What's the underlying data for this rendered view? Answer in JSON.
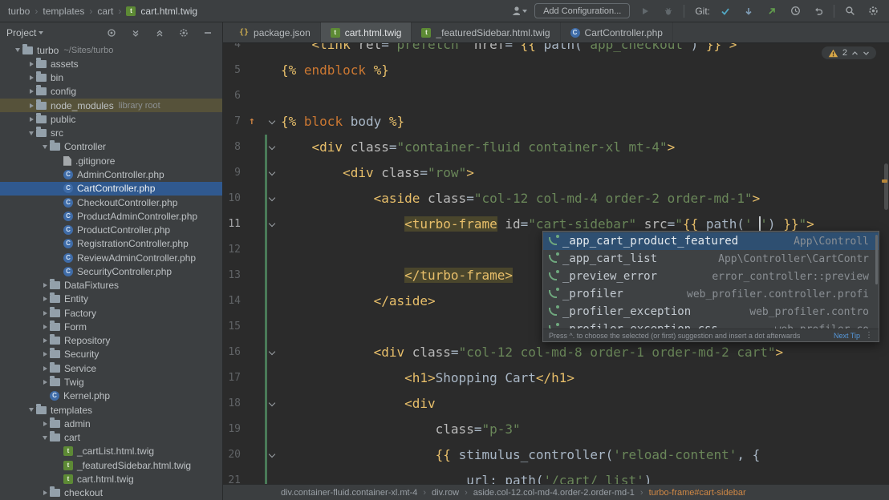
{
  "colors": {
    "editor_bg": "#2b2b2b",
    "panel_bg": "#3c3f41",
    "selection_blue": "#30598f",
    "library_highlight": "#56523a",
    "tag_yellow": "#e8bf6a",
    "string_green": "#6a8759",
    "keyword_orange": "#cc7832",
    "warning_yellow": "#d9a848",
    "breadcrumb_current": "#d08845"
  },
  "icons": {
    "breadcrumb_separator": "›",
    "overflow_menu": "⋮",
    "block_override_arrow": "↑"
  },
  "titlebar": {
    "path": [
      "turbo",
      "templates",
      "cart",
      "cart.html.twig"
    ],
    "add_config": "Add Configuration...",
    "git_label": "Git:"
  },
  "project": {
    "title": "Project",
    "items": [
      {
        "label": "turbo",
        "sub": "~/Sites/turbo",
        "type": "folder",
        "level": 0,
        "arrow": "open"
      },
      {
        "label": "assets",
        "type": "folder",
        "level": 1,
        "arrow": "closed"
      },
      {
        "label": "bin",
        "type": "folder",
        "level": 1,
        "arrow": "closed"
      },
      {
        "label": "config",
        "type": "folder",
        "level": 1,
        "arrow": "closed"
      },
      {
        "label": "node_modules",
        "sub": "library root",
        "type": "folder",
        "level": 1,
        "arrow": "closed",
        "highlight": true
      },
      {
        "label": "public",
        "type": "folder",
        "level": 1,
        "arrow": "closed"
      },
      {
        "label": "src",
        "type": "folder",
        "level": 1,
        "arrow": "open"
      },
      {
        "label": "Controller",
        "type": "folder",
        "level": 2,
        "arrow": "open"
      },
      {
        "label": ".gitignore",
        "type": "git",
        "level": 3
      },
      {
        "label": "AdminController.php",
        "type": "php",
        "level": 3
      },
      {
        "label": "CartController.php",
        "type": "php",
        "level": 3,
        "selected": true
      },
      {
        "label": "CheckoutController.php",
        "type": "php",
        "level": 3
      },
      {
        "label": "ProductAdminController.php",
        "type": "php",
        "level": 3
      },
      {
        "label": "ProductController.php",
        "type": "php",
        "level": 3
      },
      {
        "label": "RegistrationController.php",
        "type": "php",
        "level": 3
      },
      {
        "label": "ReviewAdminController.php",
        "type": "php",
        "level": 3
      },
      {
        "label": "SecurityController.php",
        "type": "php",
        "level": 3
      },
      {
        "label": "DataFixtures",
        "type": "folder",
        "level": 2,
        "arrow": "closed"
      },
      {
        "label": "Entity",
        "type": "folder",
        "level": 2,
        "arrow": "closed"
      },
      {
        "label": "Factory",
        "type": "folder",
        "level": 2,
        "arrow": "closed"
      },
      {
        "label": "Form",
        "type": "folder",
        "level": 2,
        "arrow": "closed"
      },
      {
        "label": "Repository",
        "type": "folder",
        "level": 2,
        "arrow": "closed"
      },
      {
        "label": "Security",
        "type": "folder",
        "level": 2,
        "arrow": "closed"
      },
      {
        "label": "Service",
        "type": "folder",
        "level": 2,
        "arrow": "closed"
      },
      {
        "label": "Twig",
        "type": "folder",
        "level": 2,
        "arrow": "closed"
      },
      {
        "label": "Kernel.php",
        "type": "php",
        "level": 2
      },
      {
        "label": "templates",
        "type": "folder",
        "level": 1,
        "arrow": "open"
      },
      {
        "label": "admin",
        "type": "folder",
        "level": 2,
        "arrow": "closed"
      },
      {
        "label": "cart",
        "type": "folder",
        "level": 2,
        "arrow": "open"
      },
      {
        "label": "_cartList.html.twig",
        "type": "twig",
        "level": 3
      },
      {
        "label": "_featuredSidebar.html.twig",
        "type": "twig",
        "level": 3
      },
      {
        "label": "cart.html.twig",
        "type": "twig",
        "level": 3
      },
      {
        "label": "checkout",
        "type": "folder",
        "level": 2,
        "arrow": "closed"
      }
    ]
  },
  "tabs": [
    {
      "label": "package.json",
      "icon": "json"
    },
    {
      "label": "cart.html.twig",
      "icon": "twig",
      "active": true
    },
    {
      "label": "_featuredSidebar.html.twig",
      "icon": "twig"
    },
    {
      "label": "CartController.php",
      "icon": "php"
    }
  ],
  "editor": {
    "lines": [
      {
        "num": 4,
        "tokens": [
          [
            "    ",
            "plain"
          ],
          [
            "<link",
            "tag"
          ],
          [
            " rel",
            "attr"
          ],
          [
            "=",
            "plain"
          ],
          [
            "\"prefetch\"",
            "str"
          ],
          [
            " href",
            "attr"
          ],
          [
            "=",
            "plain"
          ],
          [
            "\"",
            "str"
          ],
          [
            "{{ ",
            "twig"
          ],
          [
            "path(",
            "plain"
          ],
          [
            "'app_checkout'",
            "str"
          ],
          [
            ")",
            "plain"
          ],
          [
            " }}",
            "twig"
          ],
          [
            "\"",
            "str"
          ],
          [
            ">",
            "tag"
          ]
        ]
      },
      {
        "num": 5,
        "tokens": [
          [
            "{% ",
            "twig"
          ],
          [
            "endblock",
            "kw"
          ],
          [
            " %}",
            "twig"
          ]
        ]
      },
      {
        "num": 6,
        "tokens": []
      },
      {
        "num": 7,
        "icon": "override",
        "fold": true,
        "tokens": [
          [
            "{% ",
            "twig"
          ],
          [
            "block",
            "kw"
          ],
          [
            " body",
            "plain"
          ],
          [
            " %}",
            "twig"
          ]
        ]
      },
      {
        "num": 8,
        "fold": true,
        "vcs": true,
        "tokens": [
          [
            "    ",
            "plain"
          ],
          [
            "<div",
            "tag"
          ],
          [
            " class",
            "attr"
          ],
          [
            "=",
            "plain"
          ],
          [
            "\"container-fluid container-xl mt-4\"",
            "str"
          ],
          [
            ">",
            "tag"
          ]
        ]
      },
      {
        "num": 9,
        "fold": true,
        "vcs": true,
        "tokens": [
          [
            "        ",
            "plain"
          ],
          [
            "<div",
            "tag"
          ],
          [
            " class",
            "attr"
          ],
          [
            "=",
            "plain"
          ],
          [
            "\"row\"",
            "str"
          ],
          [
            ">",
            "tag"
          ]
        ]
      },
      {
        "num": 10,
        "fold": true,
        "vcs": true,
        "tokens": [
          [
            "            ",
            "plain"
          ],
          [
            "<aside",
            "tag"
          ],
          [
            " class",
            "attr"
          ],
          [
            "=",
            "plain"
          ],
          [
            "\"col-12 col-md-4 order-2 order-md-1\"",
            "str"
          ],
          [
            ">",
            "tag"
          ]
        ]
      },
      {
        "num": 11,
        "cur": true,
        "fold": true,
        "vcs": true,
        "tokens": [
          [
            "                ",
            "plain"
          ],
          [
            "<turbo-frame",
            "taghl"
          ],
          [
            " id",
            "attr"
          ],
          [
            "=",
            "plain"
          ],
          [
            "\"cart-sidebar\"",
            "str"
          ],
          [
            " src",
            "attr"
          ],
          [
            "=",
            "plain"
          ],
          [
            "\"",
            "str"
          ],
          [
            "{{ ",
            "twig"
          ],
          [
            "path(",
            "plain"
          ],
          [
            "'_",
            "str"
          ],
          [
            "",
            "caret"
          ],
          [
            "'",
            "str"
          ],
          [
            ")",
            "plain"
          ],
          [
            " }}",
            "twig"
          ],
          [
            "\"",
            "str"
          ],
          [
            ">",
            "tag"
          ]
        ]
      },
      {
        "num": 12,
        "vcs": true,
        "tokens": []
      },
      {
        "num": 13,
        "vcs": true,
        "tokens": [
          [
            "                ",
            "plain"
          ],
          [
            "</turbo-frame>",
            "taghl"
          ]
        ]
      },
      {
        "num": 14,
        "vcs": true,
        "tokens": [
          [
            "            ",
            "plain"
          ],
          [
            "</aside>",
            "tag"
          ]
        ]
      },
      {
        "num": 15,
        "vcs": true,
        "tokens": []
      },
      {
        "num": 16,
        "fold": true,
        "vcs": true,
        "tokens": [
          [
            "            ",
            "plain"
          ],
          [
            "<div",
            "tag"
          ],
          [
            " class",
            "attr"
          ],
          [
            "=",
            "plain"
          ],
          [
            "\"col-12 col-md-8 order-1 order-md-2 cart\"",
            "str"
          ],
          [
            ">",
            "tag"
          ]
        ]
      },
      {
        "num": 17,
        "vcs": true,
        "tokens": [
          [
            "                ",
            "plain"
          ],
          [
            "<h1>",
            "tag"
          ],
          [
            "Shopping Cart",
            "plain"
          ],
          [
            "</h1>",
            "tag"
          ]
        ]
      },
      {
        "num": 18,
        "fold": true,
        "vcs": true,
        "tokens": [
          [
            "                ",
            "plain"
          ],
          [
            "<div",
            "tag"
          ]
        ]
      },
      {
        "num": 19,
        "vcs": true,
        "tokens": [
          [
            "                    ",
            "plain"
          ],
          [
            "class",
            "attr"
          ],
          [
            "=",
            "plain"
          ],
          [
            "\"p-3\"",
            "str"
          ]
        ]
      },
      {
        "num": 20,
        "fold": true,
        "vcs": true,
        "tokens": [
          [
            "                    ",
            "plain"
          ],
          [
            "{{ ",
            "twig"
          ],
          [
            "stimulus_controller(",
            "plain"
          ],
          [
            "'reload-content'",
            "str"
          ],
          [
            ", {",
            "plain"
          ]
        ]
      },
      {
        "num": 21,
        "vcs": true,
        "tokens": [
          [
            "                        ",
            "plain"
          ],
          [
            "url: path(",
            "plain"
          ],
          [
            "'/cart/_list'",
            "str"
          ],
          [
            ")",
            "plain"
          ]
        ]
      }
    ]
  },
  "completion": {
    "items": [
      {
        "name": "_app_cart_product_featured",
        "type": "App\\Controll",
        "selected": true
      },
      {
        "name": "_app_cart_list",
        "type": "App\\Controller\\CartContr"
      },
      {
        "name": "_preview_error",
        "type": "error_controller::preview"
      },
      {
        "name": "_profiler",
        "type": "web_profiler.controller.profi"
      },
      {
        "name": "_profiler_exception",
        "type": "web_profiler.contro"
      },
      {
        "name": "_profiler_exception_css",
        "type": "web_profiler.co"
      }
    ],
    "hint": "Press ^. to choose the selected (or first) suggestion and insert a dot afterwards",
    "hint_link": "Next Tip"
  },
  "breadcrumbs": [
    {
      "label": "div.container-fluid.container-xl.mt-4"
    },
    {
      "label": "div.row"
    },
    {
      "label": "aside.col-12.col-md-4.order-2.order-md-1"
    },
    {
      "label": "turbo-frame#cart-sidebar",
      "current": true
    }
  ],
  "inspections": {
    "warnings": "2"
  }
}
